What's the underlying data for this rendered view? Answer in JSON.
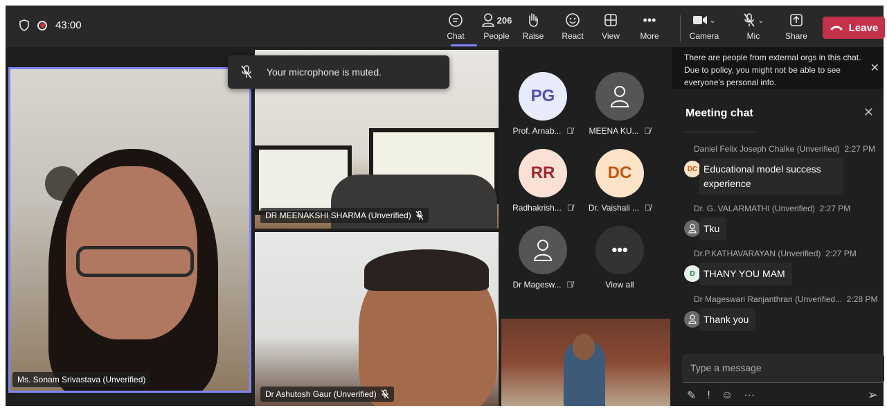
{
  "topbar": {
    "timer": "43:00",
    "controls": {
      "chat": "Chat",
      "people": "People",
      "people_count": "206",
      "raise": "Raise",
      "react": "React",
      "view": "View",
      "more": "More",
      "camera": "Camera",
      "mic": "Mic",
      "share": "Share",
      "leave": "Leave"
    },
    "colors": {
      "leave": "#c4314b",
      "active_underline": "#7f85f5"
    }
  },
  "toast": {
    "text": "Your microphone is muted."
  },
  "tiles": {
    "sonam": "Ms. Sonam Srivastava (Unverified)",
    "meenakshi": "DR MEENAKSHI SHARMA (Unverified)",
    "ashutosh": "Dr Ashutosh Gaur (Unverified)"
  },
  "participants": [
    {
      "initials": "PG",
      "name": "Prof. Arnab..."
    },
    {
      "initials": "",
      "name": "MEENA KU..."
    },
    {
      "initials": "RR",
      "name": "Radhakrish..."
    },
    {
      "initials": "DC",
      "name": "Dr. Vaishali ..."
    },
    {
      "initials": "",
      "name": "Dr Magesw..."
    },
    {
      "initials": "•••",
      "name": "View all"
    }
  ],
  "chat": {
    "external_notice": "There are people from external orgs in this chat. Due to policy, you might not be able to see everyone's personal info.",
    "title": "Meeting chat",
    "messages": [
      {
        "sender": "Daniel Felix Joseph Chalke (Unverified)",
        "time": "2:27 PM",
        "initials": "DC",
        "text": "Educational model success experience"
      },
      {
        "sender": "Dr. G. VALARMATHI (Unverified)",
        "time": "2:27 PM",
        "initials": "",
        "text": "Tku"
      },
      {
        "sender": "Dr.P.KATHAVARAYAN (Unverified)",
        "time": "2:27 PM",
        "initials": "D",
        "text": "THANY YOU MAM"
      },
      {
        "sender": "Dr Mageswari Ranjanthran (Unverified...",
        "time": "2:28 PM",
        "initials": "",
        "text": "Thank you"
      }
    ],
    "compose_placeholder": "Type a message"
  }
}
